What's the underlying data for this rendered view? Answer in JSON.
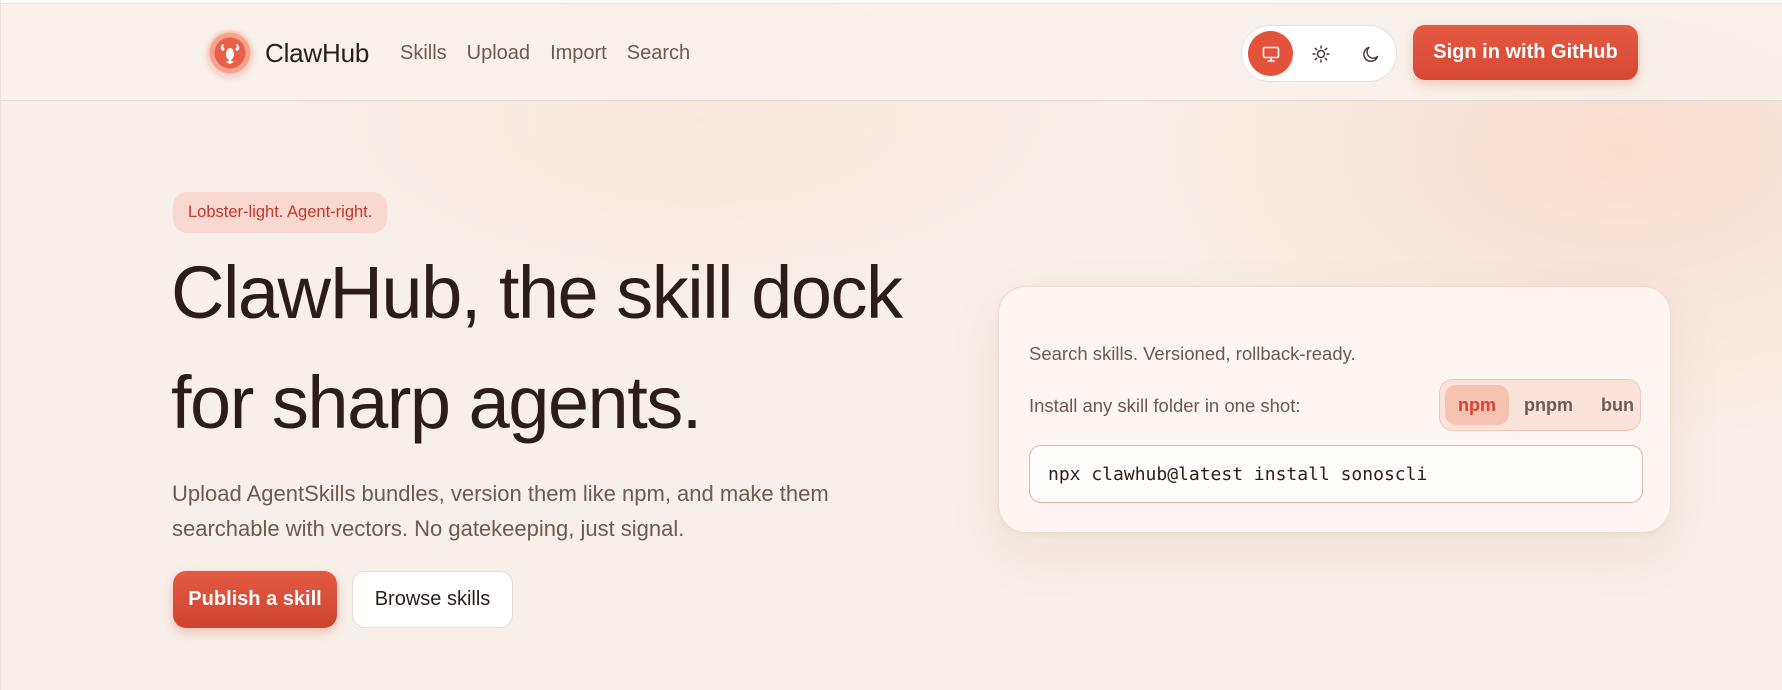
{
  "header": {
    "brand": "ClawHub",
    "nav": [
      "Skills",
      "Upload",
      "Import",
      "Search"
    ],
    "theme": {
      "options": [
        "system-icon",
        "sun-icon",
        "moon-icon"
      ],
      "selected": "system"
    },
    "signin_label": "Sign in  with GitHub"
  },
  "hero": {
    "tagline": "Lobster-light. Agent-right.",
    "title_line1": "ClawHub, the skill dock",
    "title_line2": "for sharp agents.",
    "subtitle_line1": "Upload AgentSkills bundles, version them like npm, and make them",
    "subtitle_line2": "searchable with vectors. No gatekeeping, just signal.",
    "primary_button": "Publish a skill",
    "secondary_button": "Browse skills"
  },
  "install": {
    "line1": "Search skills. Versioned, rollback-ready.",
    "line2": "Install any skill folder in one shot:",
    "package_managers": [
      "npm",
      "pnpm",
      "bun"
    ],
    "selected_pm": "npm",
    "command": "npx clawhub@latest install sonoscli"
  },
  "colors": {
    "accent": "#e3533c",
    "background": "#f7efe9",
    "text": "#2b1d17",
    "muted": "#6d5a51"
  }
}
